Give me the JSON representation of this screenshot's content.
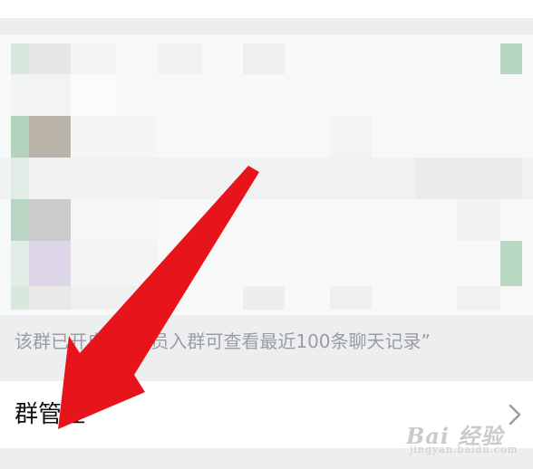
{
  "group_info": {
    "history_notice": "该群已开启“新成员入群可查看最近100条聊天记录”"
  },
  "menu": {
    "group_management_label": "群管理",
    "chevron_icon": "chevron-right-icon"
  },
  "watermark": {
    "logo_text": "Bai 经验",
    "url_text": "jingyan.baidu.com"
  },
  "annotation": {
    "arrow_color": "#e8141c"
  }
}
